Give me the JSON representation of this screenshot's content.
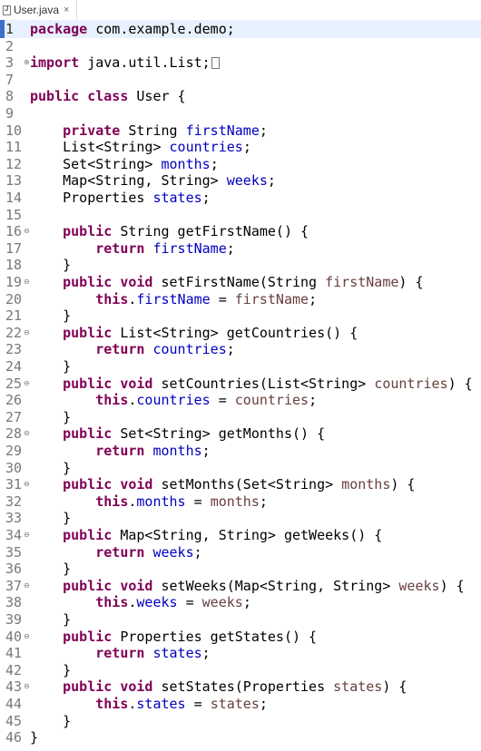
{
  "tab": {
    "label": "User.java",
    "close": "×"
  },
  "lines": [
    {
      "n": "1",
      "segs": [
        [
          "k",
          "package"
        ],
        [
          "t",
          " com.example.demo;"
        ]
      ]
    },
    {
      "n": "2",
      "segs": []
    },
    {
      "n": "3",
      "fold": "+",
      "segs": [
        [
          "k",
          "import"
        ],
        [
          "t",
          " java.util.List;"
        ],
        [
          "box",
          ""
        ]
      ]
    },
    {
      "n": "7",
      "segs": []
    },
    {
      "n": "8",
      "segs": [
        [
          "k",
          "public class"
        ],
        [
          "t",
          " User {"
        ]
      ]
    },
    {
      "n": "9",
      "segs": []
    },
    {
      "n": "10",
      "segs": [
        [
          "t",
          "    "
        ],
        [
          "k",
          "private"
        ],
        [
          "t",
          " String "
        ],
        [
          "f",
          "firstName"
        ],
        [
          "t",
          ";"
        ]
      ]
    },
    {
      "n": "11",
      "segs": [
        [
          "t",
          "    List<String> "
        ],
        [
          "f",
          "countries"
        ],
        [
          "t",
          ";"
        ]
      ]
    },
    {
      "n": "12",
      "segs": [
        [
          "t",
          "    Set<String> "
        ],
        [
          "f",
          "months"
        ],
        [
          "t",
          ";"
        ]
      ]
    },
    {
      "n": "13",
      "segs": [
        [
          "t",
          "    Map<String, String> "
        ],
        [
          "f",
          "weeks"
        ],
        [
          "t",
          ";"
        ]
      ]
    },
    {
      "n": "14",
      "segs": [
        [
          "t",
          "    Properties "
        ],
        [
          "f",
          "states"
        ],
        [
          "t",
          ";"
        ]
      ]
    },
    {
      "n": "15",
      "segs": []
    },
    {
      "n": "16",
      "fold": "-",
      "segs": [
        [
          "t",
          "    "
        ],
        [
          "k",
          "public"
        ],
        [
          "t",
          " String getFirstName() {"
        ]
      ]
    },
    {
      "n": "17",
      "segs": [
        [
          "t",
          "        "
        ],
        [
          "k",
          "return"
        ],
        [
          "t",
          " "
        ],
        [
          "f",
          "firstName"
        ],
        [
          "t",
          ";"
        ]
      ]
    },
    {
      "n": "18",
      "segs": [
        [
          "t",
          "    }"
        ]
      ]
    },
    {
      "n": "19",
      "fold": "-",
      "segs": [
        [
          "t",
          "    "
        ],
        [
          "k",
          "public void"
        ],
        [
          "t",
          " setFirstName(String "
        ],
        [
          "p",
          "firstName"
        ],
        [
          "t",
          ") {"
        ]
      ]
    },
    {
      "n": "20",
      "segs": [
        [
          "t",
          "        "
        ],
        [
          "k",
          "this"
        ],
        [
          "t",
          "."
        ],
        [
          "f",
          "firstName"
        ],
        [
          "t",
          " = "
        ],
        [
          "p",
          "firstName"
        ],
        [
          "t",
          ";"
        ]
      ]
    },
    {
      "n": "21",
      "segs": [
        [
          "t",
          "    }"
        ]
      ]
    },
    {
      "n": "22",
      "fold": "-",
      "segs": [
        [
          "t",
          "    "
        ],
        [
          "k",
          "public"
        ],
        [
          "t",
          " List<String> getCountries() {"
        ]
      ]
    },
    {
      "n": "23",
      "segs": [
        [
          "t",
          "        "
        ],
        [
          "k",
          "return"
        ],
        [
          "t",
          " "
        ],
        [
          "f",
          "countries"
        ],
        [
          "t",
          ";"
        ]
      ]
    },
    {
      "n": "24",
      "segs": [
        [
          "t",
          "    }"
        ]
      ]
    },
    {
      "n": "25",
      "fold": "-",
      "segs": [
        [
          "t",
          "    "
        ],
        [
          "k",
          "public void"
        ],
        [
          "t",
          " setCountries(List<String> "
        ],
        [
          "p",
          "countries"
        ],
        [
          "t",
          ") {"
        ]
      ]
    },
    {
      "n": "26",
      "segs": [
        [
          "t",
          "        "
        ],
        [
          "k",
          "this"
        ],
        [
          "t",
          "."
        ],
        [
          "f",
          "countries"
        ],
        [
          "t",
          " = "
        ],
        [
          "p",
          "countries"
        ],
        [
          "t",
          ";"
        ]
      ]
    },
    {
      "n": "27",
      "segs": [
        [
          "t",
          "    }"
        ]
      ]
    },
    {
      "n": "28",
      "fold": "-",
      "segs": [
        [
          "t",
          "    "
        ],
        [
          "k",
          "public"
        ],
        [
          "t",
          " Set<String> getMonths() {"
        ]
      ]
    },
    {
      "n": "29",
      "segs": [
        [
          "t",
          "        "
        ],
        [
          "k",
          "return"
        ],
        [
          "t",
          " "
        ],
        [
          "f",
          "months"
        ],
        [
          "t",
          ";"
        ]
      ]
    },
    {
      "n": "30",
      "segs": [
        [
          "t",
          "    }"
        ]
      ]
    },
    {
      "n": "31",
      "fold": "-",
      "segs": [
        [
          "t",
          "    "
        ],
        [
          "k",
          "public void"
        ],
        [
          "t",
          " setMonths(Set<String> "
        ],
        [
          "p",
          "months"
        ],
        [
          "t",
          ") {"
        ]
      ]
    },
    {
      "n": "32",
      "segs": [
        [
          "t",
          "        "
        ],
        [
          "k",
          "this"
        ],
        [
          "t",
          "."
        ],
        [
          "f",
          "months"
        ],
        [
          "t",
          " = "
        ],
        [
          "p",
          "months"
        ],
        [
          "t",
          ";"
        ]
      ]
    },
    {
      "n": "33",
      "segs": [
        [
          "t",
          "    }"
        ]
      ]
    },
    {
      "n": "34",
      "fold": "-",
      "segs": [
        [
          "t",
          "    "
        ],
        [
          "k",
          "public"
        ],
        [
          "t",
          " Map<String, String> getWeeks() {"
        ]
      ]
    },
    {
      "n": "35",
      "segs": [
        [
          "t",
          "        "
        ],
        [
          "k",
          "return"
        ],
        [
          "t",
          " "
        ],
        [
          "f",
          "weeks"
        ],
        [
          "t",
          ";"
        ]
      ]
    },
    {
      "n": "36",
      "segs": [
        [
          "t",
          "    }"
        ]
      ]
    },
    {
      "n": "37",
      "fold": "-",
      "segs": [
        [
          "t",
          "    "
        ],
        [
          "k",
          "public void"
        ],
        [
          "t",
          " setWeeks(Map<String, String> "
        ],
        [
          "p",
          "weeks"
        ],
        [
          "t",
          ") {"
        ]
      ]
    },
    {
      "n": "38",
      "segs": [
        [
          "t",
          "        "
        ],
        [
          "k",
          "this"
        ],
        [
          "t",
          "."
        ],
        [
          "f",
          "weeks"
        ],
        [
          "t",
          " = "
        ],
        [
          "p",
          "weeks"
        ],
        [
          "t",
          ";"
        ]
      ]
    },
    {
      "n": "39",
      "segs": [
        [
          "t",
          "    }"
        ]
      ]
    },
    {
      "n": "40",
      "fold": "-",
      "segs": [
        [
          "t",
          "    "
        ],
        [
          "k",
          "public"
        ],
        [
          "t",
          " Properties getStates() {"
        ]
      ]
    },
    {
      "n": "41",
      "segs": [
        [
          "t",
          "        "
        ],
        [
          "k",
          "return"
        ],
        [
          "t",
          " "
        ],
        [
          "f",
          "states"
        ],
        [
          "t",
          ";"
        ]
      ]
    },
    {
      "n": "42",
      "segs": [
        [
          "t",
          "    }"
        ]
      ]
    },
    {
      "n": "43",
      "fold": "-",
      "segs": [
        [
          "t",
          "    "
        ],
        [
          "k",
          "public void"
        ],
        [
          "t",
          " setStates(Properties "
        ],
        [
          "p",
          "states"
        ],
        [
          "t",
          ") {"
        ]
      ]
    },
    {
      "n": "44",
      "segs": [
        [
          "t",
          "        "
        ],
        [
          "k",
          "this"
        ],
        [
          "t",
          "."
        ],
        [
          "f",
          "states"
        ],
        [
          "t",
          " = "
        ],
        [
          "p",
          "states"
        ],
        [
          "t",
          ";"
        ]
      ]
    },
    {
      "n": "45",
      "segs": [
        [
          "t",
          "    }"
        ]
      ]
    },
    {
      "n": "46",
      "segs": [
        [
          "t",
          "}"
        ]
      ]
    }
  ]
}
